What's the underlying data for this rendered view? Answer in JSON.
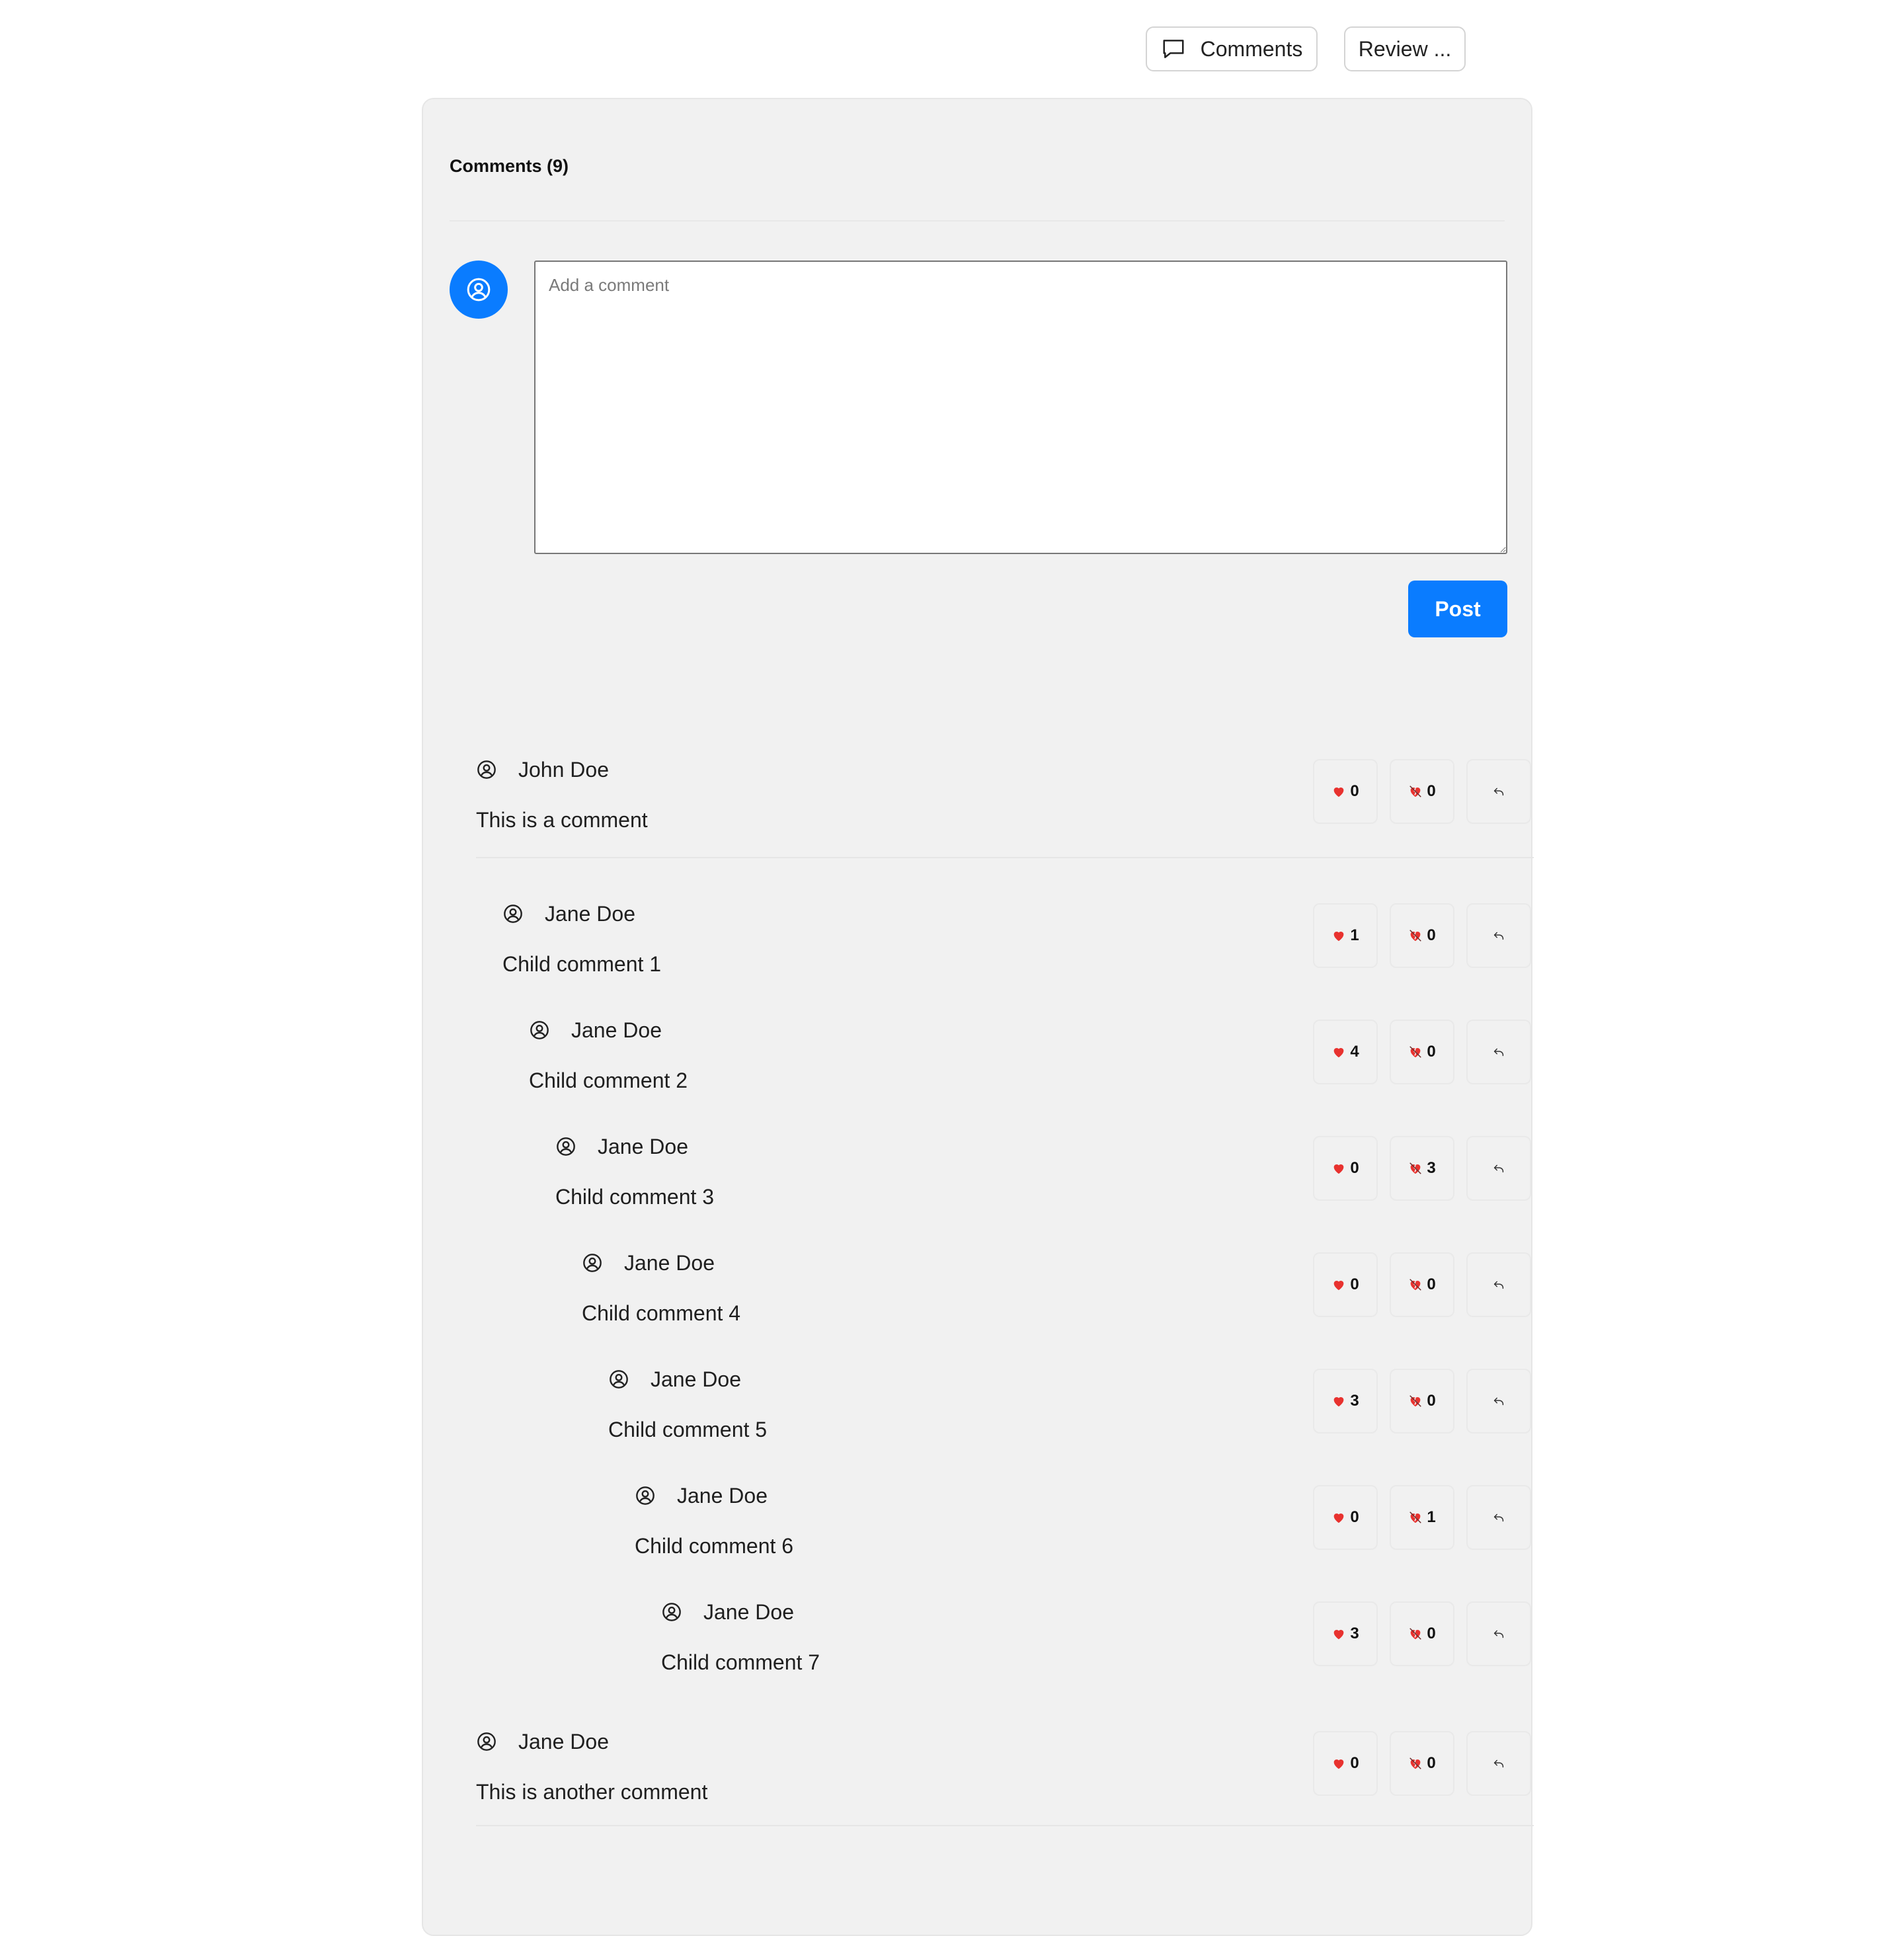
{
  "toolbar": {
    "comments_label": "Comments",
    "review_label": "Review ..."
  },
  "panel": {
    "title": "Comments (9)",
    "input_placeholder": "Add a comment",
    "post_label": "Post"
  },
  "comments": [
    {
      "author": "John Doe",
      "text": "This is a comment",
      "likes": "0",
      "dislikes": "0"
    },
    {
      "author": "Jane Doe",
      "text": "Child comment 1",
      "likes": "1",
      "dislikes": "0"
    },
    {
      "author": "Jane Doe",
      "text": "Child comment 2",
      "likes": "4",
      "dislikes": "0"
    },
    {
      "author": "Jane Doe",
      "text": "Child comment 3",
      "likes": "0",
      "dislikes": "3"
    },
    {
      "author": "Jane Doe",
      "text": "Child comment 4",
      "likes": "0",
      "dislikes": "0"
    },
    {
      "author": "Jane Doe",
      "text": "Child comment 5",
      "likes": "3",
      "dislikes": "0"
    },
    {
      "author": "Jane Doe",
      "text": "Child comment 6",
      "likes": "0",
      "dislikes": "1"
    },
    {
      "author": "Jane Doe",
      "text": "Child comment 7",
      "likes": "3",
      "dislikes": "0"
    },
    {
      "author": "Jane Doe",
      "text": "This is another comment",
      "likes": "0",
      "dislikes": "0"
    }
  ],
  "colors": {
    "accent": "#0a7cff",
    "heart": "#e8322f",
    "panel": "#f1f1f1"
  }
}
